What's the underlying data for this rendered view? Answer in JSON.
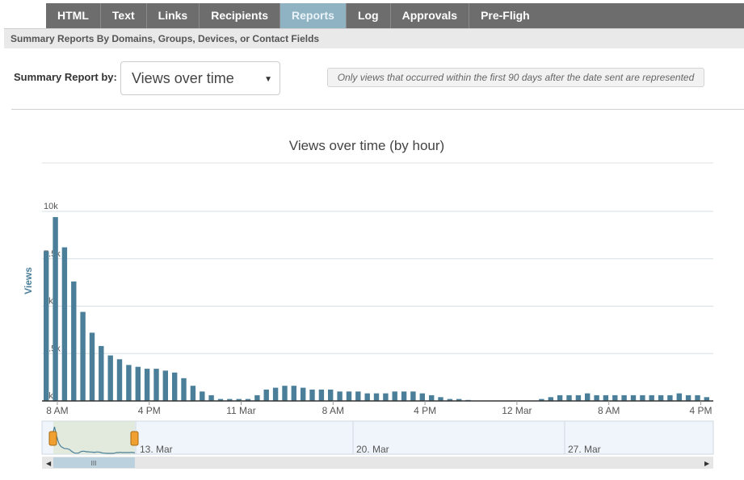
{
  "tabs": [
    {
      "label": "HTML",
      "active": false
    },
    {
      "label": "Text",
      "active": false
    },
    {
      "label": "Links",
      "active": false
    },
    {
      "label": "Recipients",
      "active": false
    },
    {
      "label": "Reports",
      "active": true
    },
    {
      "label": "Log",
      "active": false
    },
    {
      "label": "Approvals",
      "active": false
    },
    {
      "label": "Pre-Flight",
      "active": false
    }
  ],
  "subheader": "Summary Reports By Domains, Groups, Devices, or Contact Fields",
  "controls": {
    "label": "Summary Report by:",
    "selected": "Views over time",
    "caret_icon": "caret-down-icon",
    "note": "Only views that occurred within the first 90 days after the date sent are represented"
  },
  "colors": {
    "accent": "#8fb3c3",
    "bar": "#4b7f99",
    "handle": "#f0a030"
  },
  "chart_data": {
    "type": "bar",
    "title": "Views over time (by hour)",
    "ylabel": "Views",
    "ylim": [
      0,
      10000
    ],
    "yticks": [
      "0k",
      "2.5k",
      "5k",
      "7.5k",
      "10k"
    ],
    "xticks": [
      "8 AM",
      "4 PM",
      "11 Mar",
      "8 AM",
      "4 PM",
      "12 Mar",
      "8 AM",
      "4 PM"
    ],
    "values": [
      7900,
      9700,
      8100,
      6300,
      4700,
      3600,
      2900,
      2400,
      2200,
      1900,
      1800,
      1700,
      1700,
      1600,
      1500,
      1200,
      800,
      500,
      300,
      100,
      100,
      100,
      100,
      300,
      600,
      700,
      800,
      800,
      700,
      600,
      600,
      600,
      500,
      500,
      500,
      400,
      400,
      400,
      500,
      500,
      500,
      400,
      300,
      200,
      100,
      100,
      50,
      0,
      0,
      0,
      0,
      0,
      0,
      0,
      100,
      200,
      300,
      300,
      300,
      400,
      300,
      300,
      300,
      300,
      300,
      300,
      300,
      300,
      300,
      400,
      300,
      300,
      200
    ],
    "navigator": {
      "labels": [
        "13. Mar",
        "20. Mar",
        "27. Mar"
      ]
    }
  }
}
